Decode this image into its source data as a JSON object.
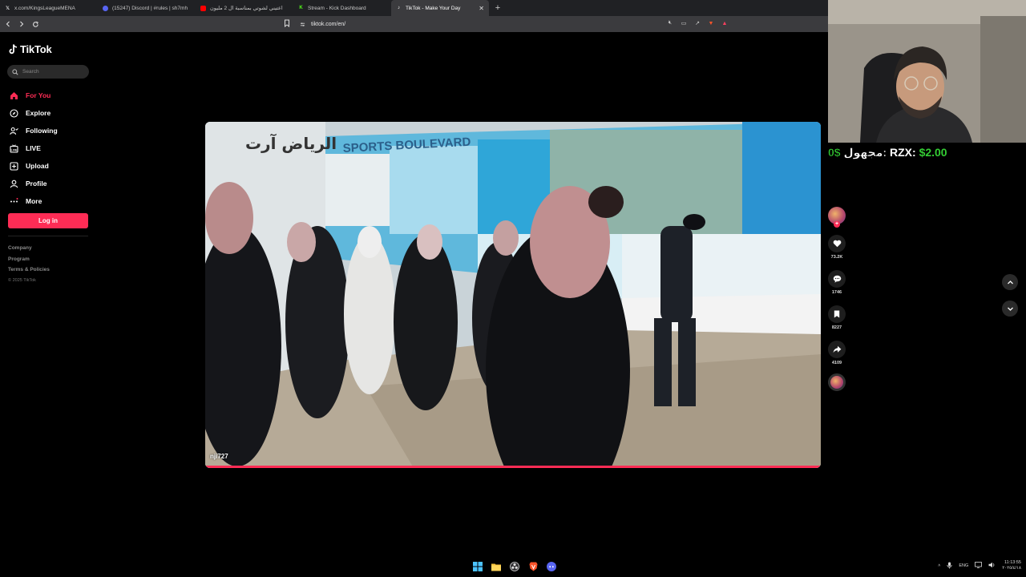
{
  "browser": {
    "tabs": [
      {
        "title": "x.com/KingsLeagueMENA",
        "icon": "x-icon",
        "active": false
      },
      {
        "title": "(15247) Discord | #rules | sh7mh",
        "icon": "discord-icon",
        "active": false
      },
      {
        "title": "اعتيني لشوتي بمناسبة ال 2 مليون",
        "icon": "youtube-icon",
        "active": false
      },
      {
        "title": "Stream - Kick Dashboard",
        "icon": "kick-icon",
        "active": false
      },
      {
        "title": "TikTok - Make Your Day",
        "icon": "tiktok-icon",
        "active": true
      }
    ],
    "url": "tiktok.com/en/"
  },
  "sidebar": {
    "logo_text": "TikTok",
    "search_placeholder": "Search",
    "nav": [
      {
        "label": "For You",
        "icon": "home-icon",
        "active": true
      },
      {
        "label": "Explore",
        "icon": "compass-icon",
        "active": false
      },
      {
        "label": "Following",
        "icon": "following-icon",
        "active": false
      },
      {
        "label": "LIVE",
        "icon": "live-icon",
        "active": false
      },
      {
        "label": "Upload",
        "icon": "upload-icon",
        "active": false
      },
      {
        "label": "Profile",
        "icon": "profile-icon",
        "active": false
      },
      {
        "label": "More",
        "icon": "more-icon",
        "active": false
      }
    ],
    "login_label": "Log in",
    "footer": {
      "links": [
        "Company",
        "Program",
        "Terms & Policies"
      ],
      "copyright": "© 2025 TikTok"
    }
  },
  "video": {
    "username": "nji727",
    "progress": 1.0,
    "sign_text": "SPORTS BOULEVARD",
    "sign_arabic": "الرياض آرت"
  },
  "actions": {
    "likes": "73.2K",
    "comments": "1746",
    "saves": "8227",
    "shares": "4109"
  },
  "overlay": {
    "donation_left_label": "مجهول:",
    "donation_left_amount": "0$",
    "donation_right_label": "RZX:",
    "donation_right_amount": "$2.00"
  },
  "taskbar": {
    "lang": "ENG",
    "time": "11:13:55",
    "date": "٢٠٢٥/٤/١٨"
  },
  "colors": {
    "accent": "#fe2c55",
    "donation_green": "#33cc33"
  }
}
